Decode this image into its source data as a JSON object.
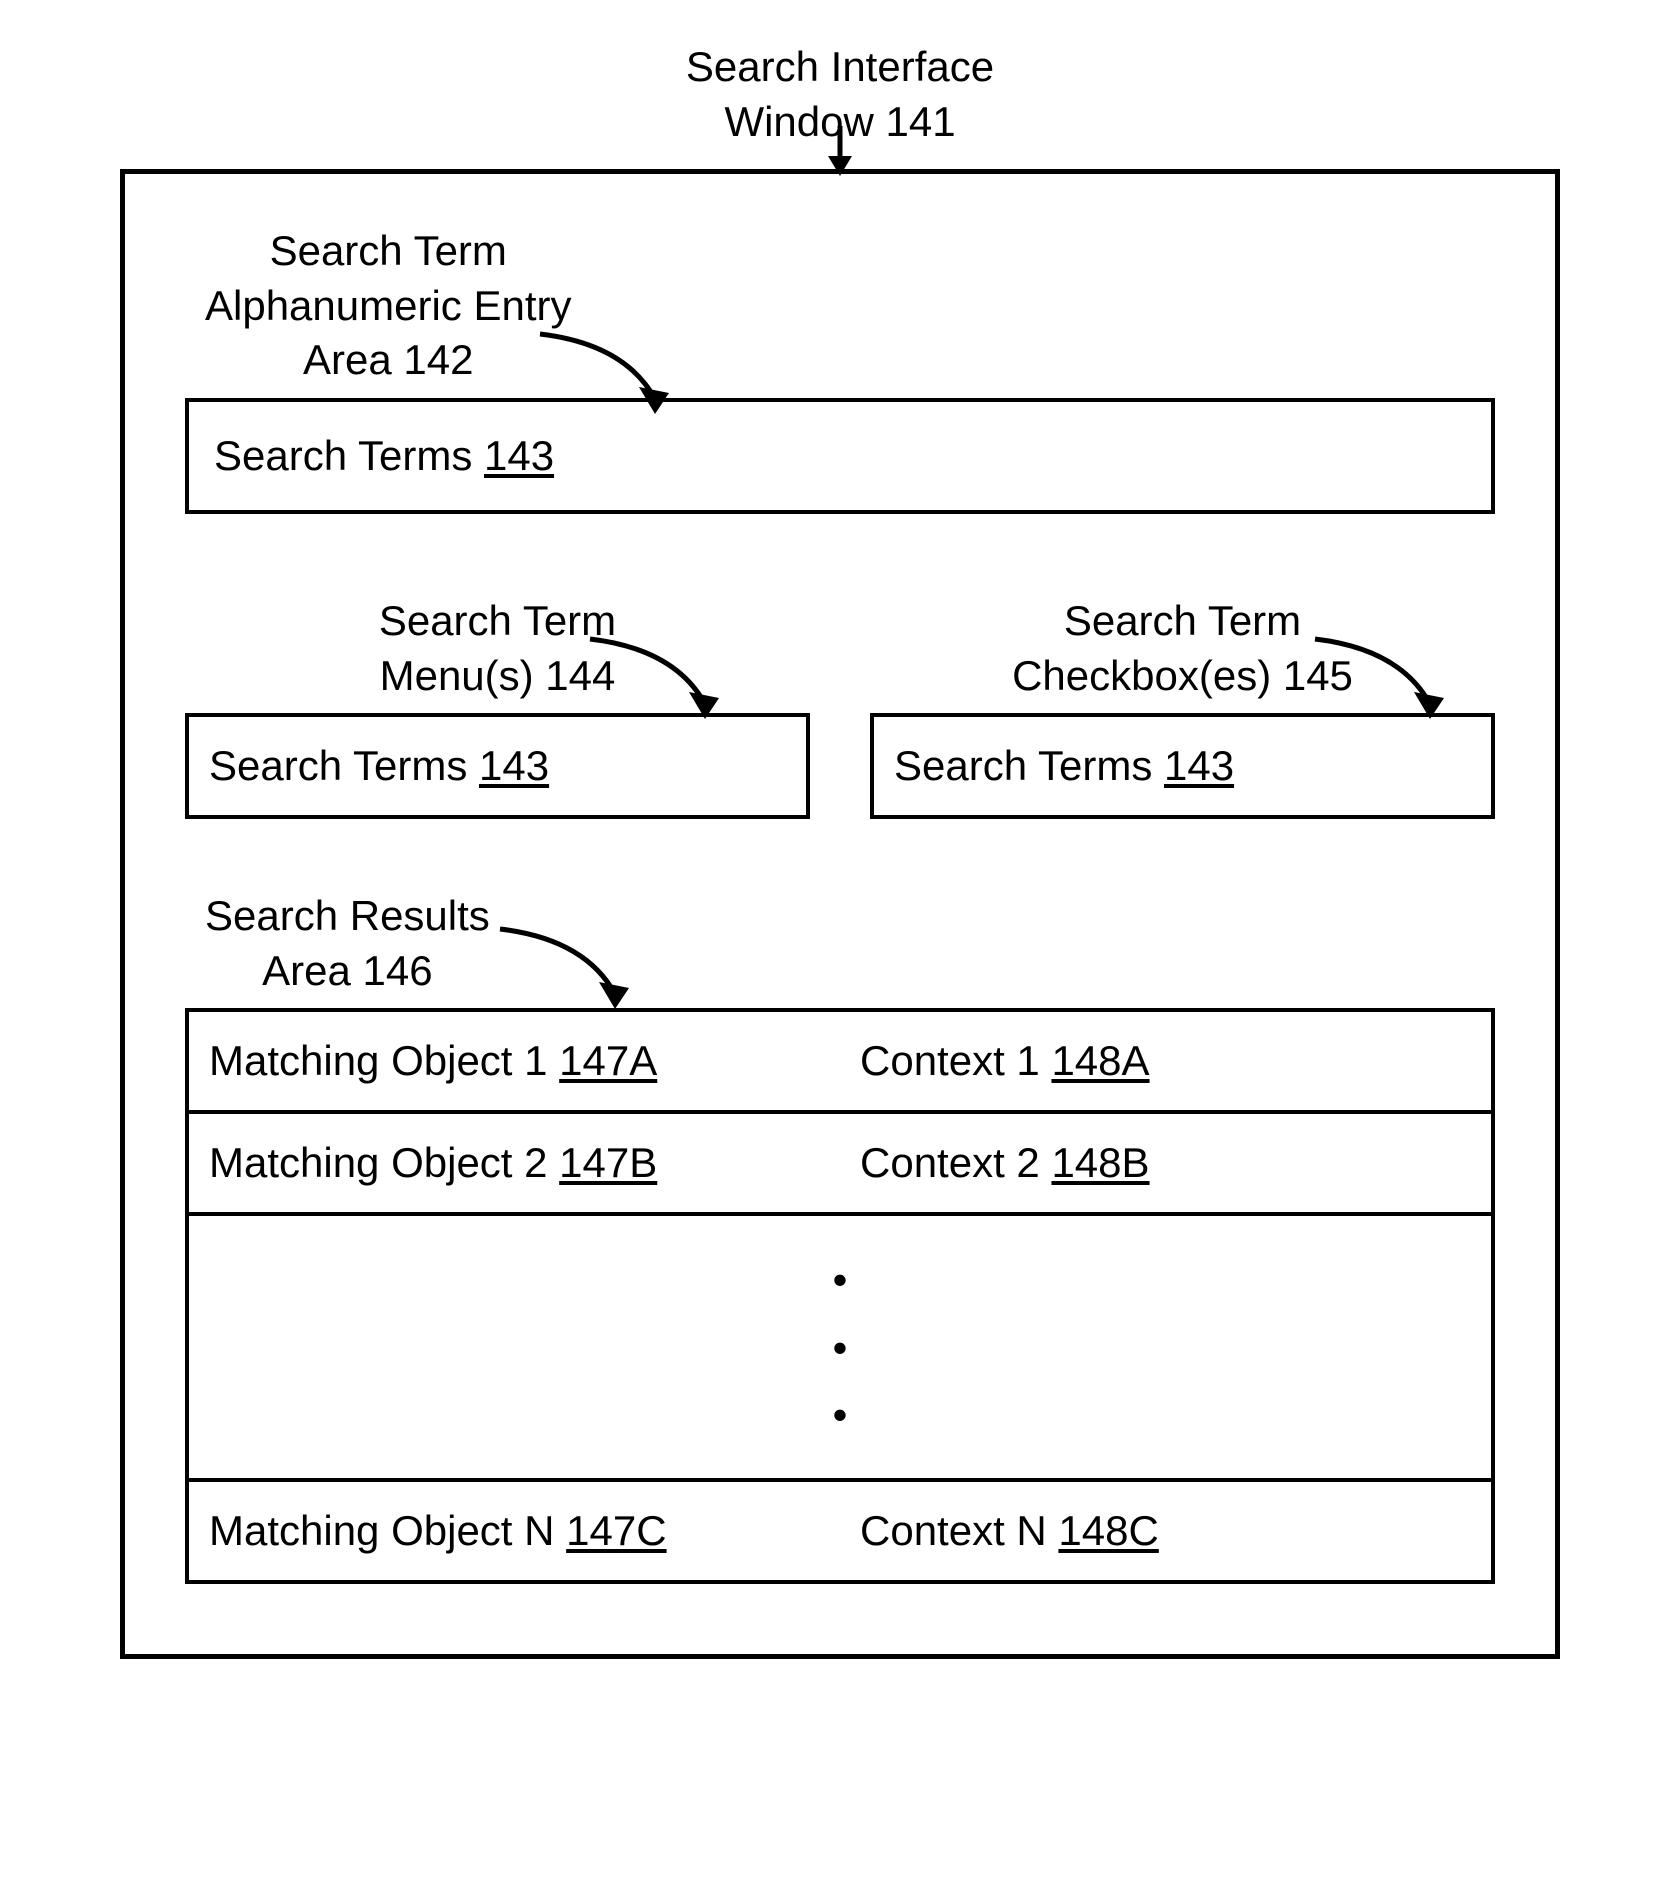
{
  "title": {
    "lines": [
      "Search Interface",
      "Window 141"
    ]
  },
  "entry_area": {
    "label_lines": [
      "Search Term",
      "Alphanumeric Entry",
      "Area 142"
    ],
    "content_prefix": "Search Terms ",
    "content_ref": "143"
  },
  "menus": {
    "label_lines": [
      "Search Term",
      "Menu(s) 144"
    ],
    "content_prefix": "Search Terms ",
    "content_ref": "143"
  },
  "checkboxes": {
    "label_lines": [
      "Search Term",
      "Checkbox(es) 145"
    ],
    "content_prefix": "Search Terms ",
    "content_ref": "143"
  },
  "results": {
    "label_lines": [
      "Search Results",
      "Area 146"
    ],
    "rows": [
      {
        "obj_prefix": "Matching Object 1 ",
        "obj_ref": "147A",
        "ctx_prefix": "Context 1 ",
        "ctx_ref": "148A"
      },
      {
        "obj_prefix": "Matching Object 2 ",
        "obj_ref": "147B",
        "ctx_prefix": "Context 2 ",
        "ctx_ref": "148B"
      }
    ],
    "last_row": {
      "obj_prefix": "Matching Object N ",
      "obj_ref": "147C",
      "ctx_prefix": "Context N ",
      "ctx_ref": "148C"
    }
  }
}
